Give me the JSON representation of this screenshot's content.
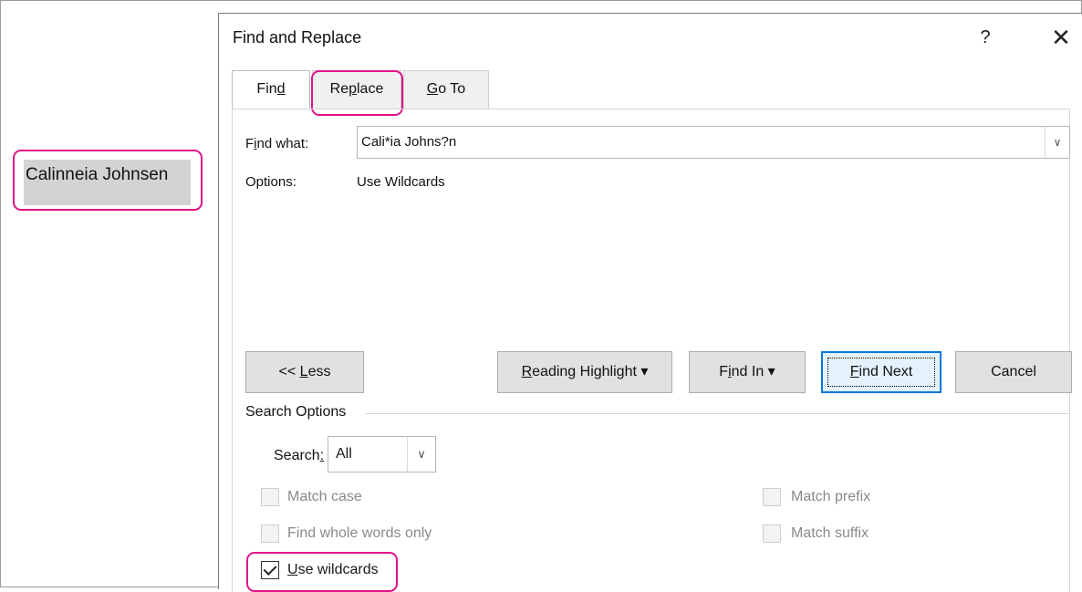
{
  "document": {
    "selected_text": "Calinneia Johnsen"
  },
  "dialog": {
    "title": "Find and Replace",
    "help_symbol": "?",
    "close_symbol": "✕",
    "tabs": [
      {
        "pre": "Fin",
        "ul": "d",
        "post": ""
      },
      {
        "pre": "Re",
        "ul": "p",
        "post": "lace"
      },
      {
        "pre": "",
        "ul": "G",
        "post": "o To"
      }
    ],
    "find_what": {
      "label_pre": "F",
      "label_ul": "i",
      "label_post": "nd what:",
      "value": "Cali*ia Johns?n"
    },
    "options": {
      "label": "Options:",
      "value": "Use Wildcards"
    },
    "buttons": {
      "less": {
        "pre": "<< ",
        "ul": "L",
        "post": "ess"
      },
      "reading_highlight": {
        "pre": "",
        "ul": "R",
        "post": "eading Highlight ▾"
      },
      "find_in": {
        "pre": "F",
        "ul": "i",
        "post": "nd In ▾"
      },
      "find_next": {
        "pre": "",
        "ul": "F",
        "post": "ind Next"
      },
      "cancel": "Cancel"
    },
    "search_options": {
      "heading": "Search Options",
      "search_label_pre": "Search",
      "search_label_ul": ":",
      "search_value": "All",
      "checkboxes": {
        "match_case": "Match case",
        "whole_words": "Find whole words only",
        "use_wildcards_ul": "U",
        "use_wildcards_post": "se wildcards",
        "match_prefix": "Match prefix",
        "match_suffix": "Match suffix"
      }
    }
  },
  "colors": {
    "highlight_outline": "#e0128a",
    "default_button": "#0078d7"
  }
}
